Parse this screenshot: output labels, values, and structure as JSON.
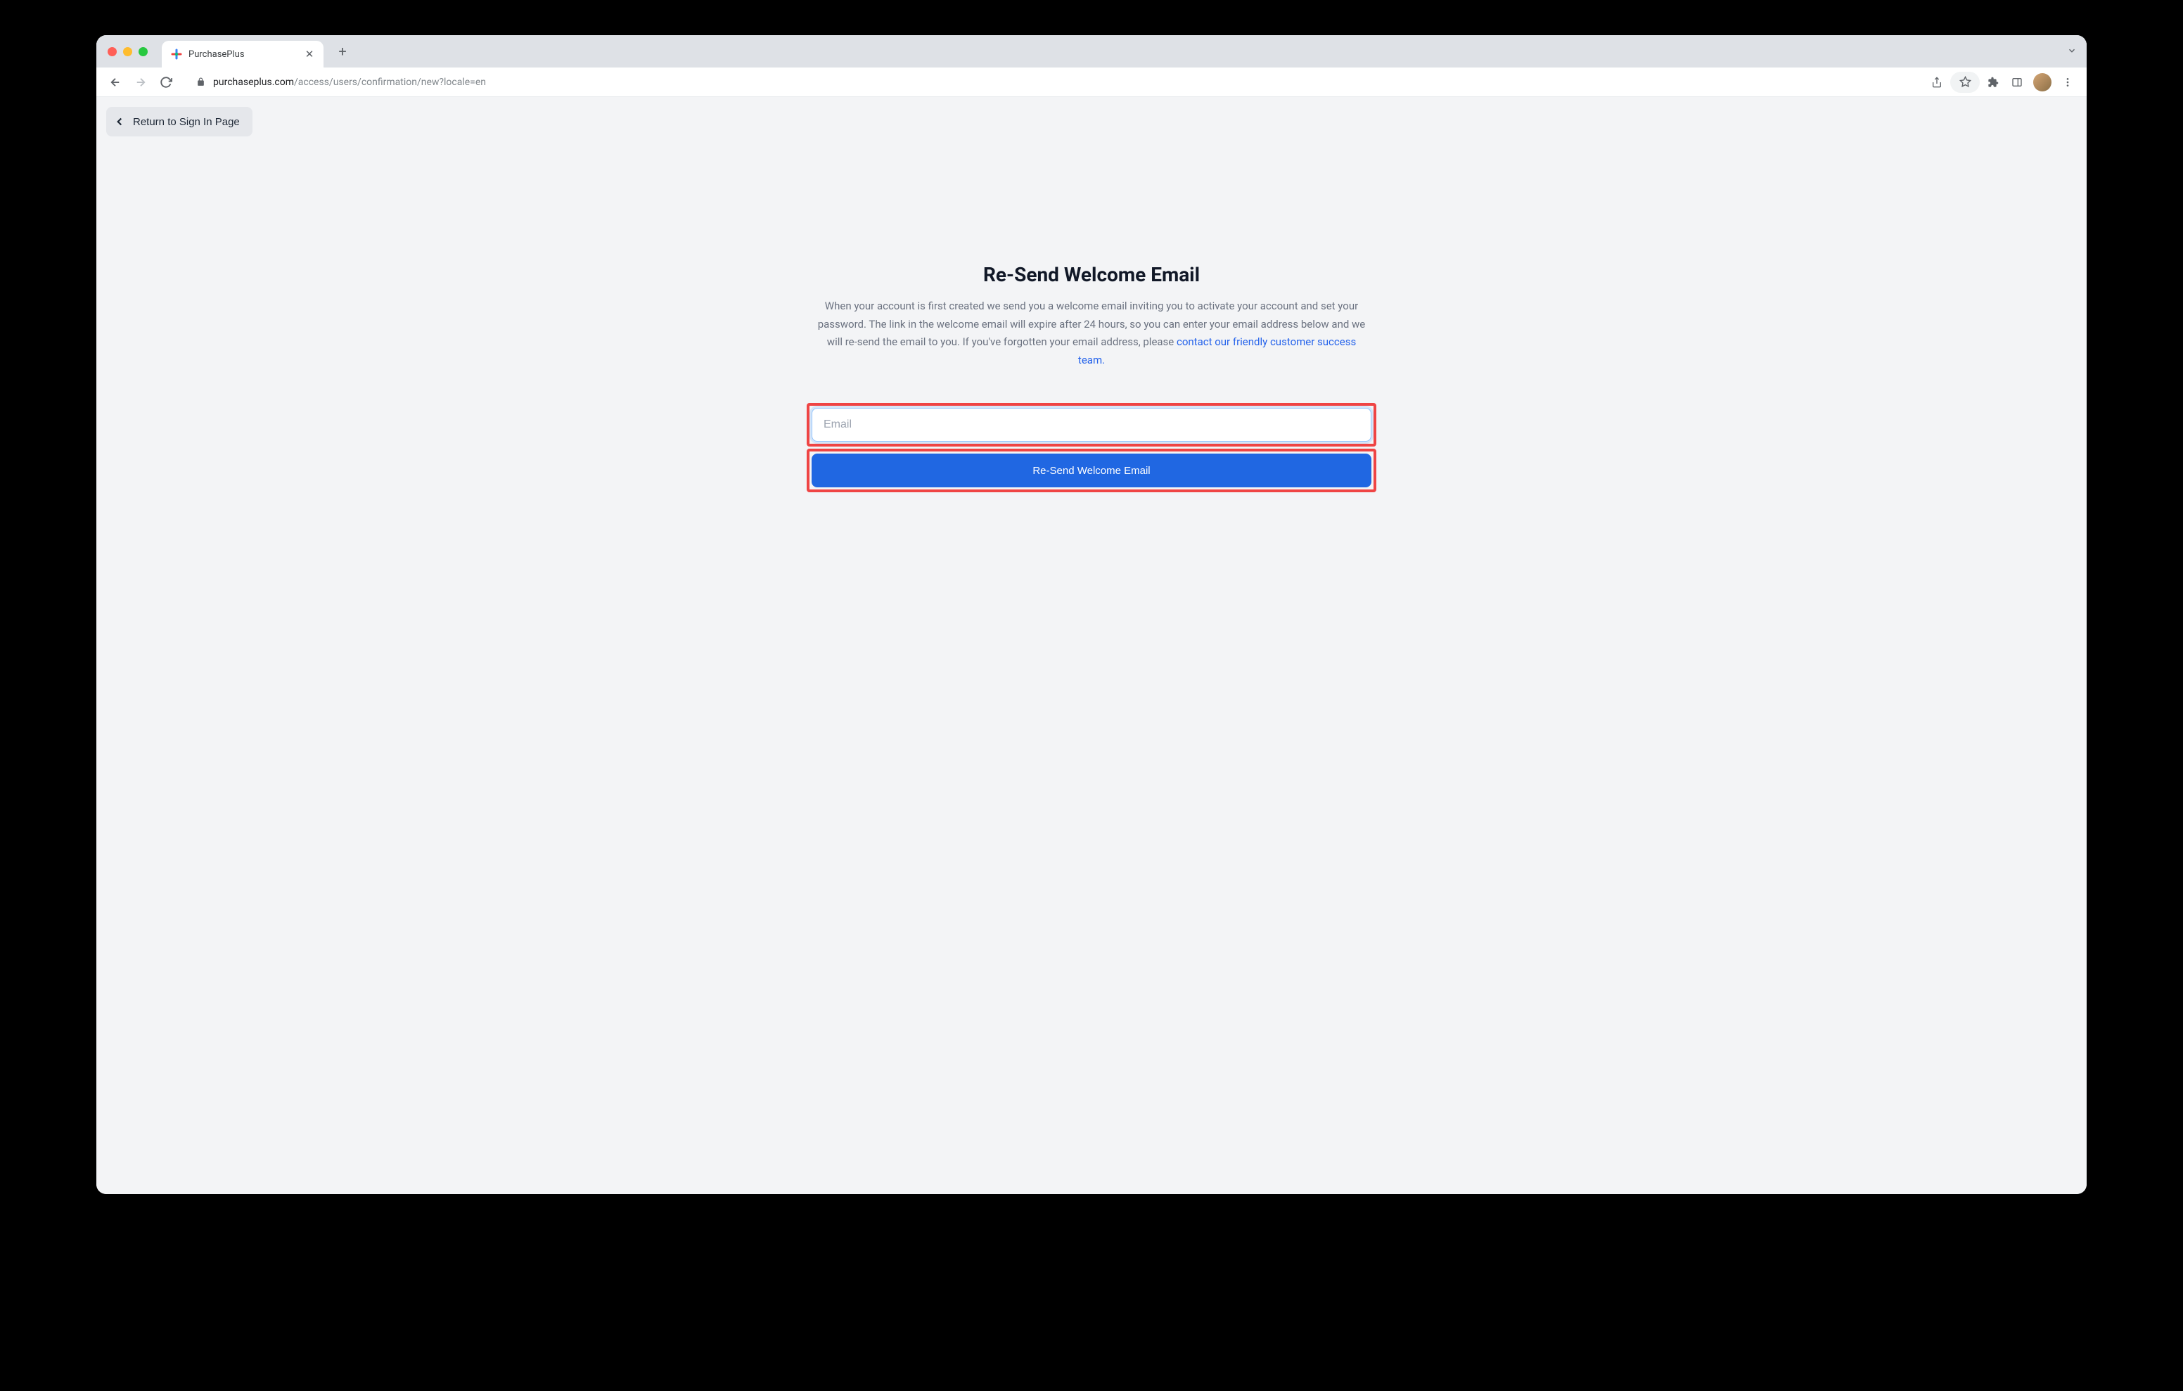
{
  "browser": {
    "tab_title": "PurchasePlus",
    "url_domain": "purchaseplus.com",
    "url_path": "/access/users/confirmation/new?locale=en"
  },
  "page": {
    "return_button": "Return to Sign In Page",
    "title": "Re-Send Welcome Email",
    "description_text": "When your account is first created we send you a welcome email inviting you to activate your account and set your password. The link in the welcome email will expire after 24 hours, so you can enter your email address below and we will re-send the email to you. If you've forgotten your email address, please ",
    "description_link": "contact our friendly customer success team.",
    "email_placeholder": "Email",
    "submit_label": "Re-Send Welcome Email"
  }
}
